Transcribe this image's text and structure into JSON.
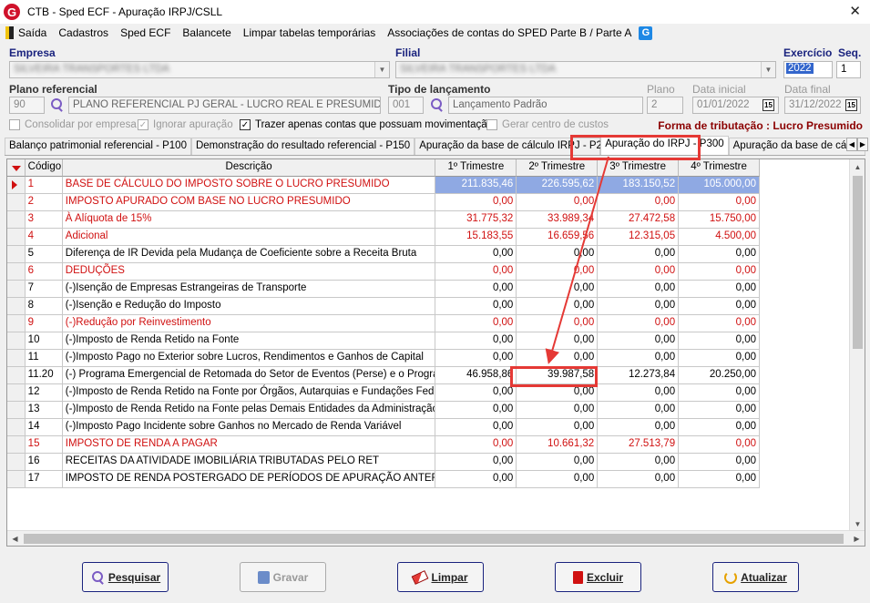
{
  "window": {
    "title": "CTB - Sped ECF - Apuração IRPJ/CSLL"
  },
  "menu": {
    "items": [
      "Saída",
      "Cadastros",
      "Sped ECF",
      "Balancete",
      "Limpar tabelas temporárias",
      "Associações de contas do SPED Parte B / Parte A"
    ]
  },
  "form": {
    "empresa_label": "Empresa",
    "empresa_value": "SILVEIRA TRANSPORTES LTDA",
    "filial_label": "Filial",
    "filial_value": "SILVEIRA TRANSPORTES LTDA",
    "exercicio_label": "Exercício",
    "exercicio_value": "2022",
    "seq_label": "Seq.",
    "seq_value": "1",
    "plano_label": "Plano referencial",
    "plano_code": "90",
    "plano_desc": "PLANO REFERENCIAL PJ GERAL - LUCRO REAL E PRESUMIDO AN",
    "tipo_label": "Tipo de lançamento",
    "tipo_code": "001",
    "tipo_desc": "Lançamento Padrão",
    "plano2_label": "Plano",
    "plano2_value": "2",
    "data_inicial_label": "Data inicial",
    "data_inicial_value": "01/01/2022",
    "data_final_label": "Data final",
    "data_final_value": "31/12/2022",
    "cal_glyph": "15",
    "chk_consolidar": "Consolidar por empresa",
    "chk_ignorar": "Ignorar apuração",
    "chk_trazer": "Trazer apenas contas que possuam movimentação",
    "chk_gerar": "Gerar centro de custos",
    "forma_tributacao": "Forma de tributação : Lucro Presumido"
  },
  "tabs": [
    "Balanço patrimonial referencial - P100",
    "Demonstração do resultado referencial - P150",
    "Apuração da base de cálculo IRPJ - P200",
    "Apuração do IRPJ - P300",
    "Apuração da base de cálculo C"
  ],
  "grid": {
    "headers": [
      "Código",
      "Descrição",
      "1º Trimestre",
      "2º Trimestre",
      "3º Trimestre",
      "4º Trimestre"
    ],
    "rows": [
      {
        "code": "1",
        "desc": "BASE DE CÁLCULO DO IMPOSTO SOBRE O LUCRO PRESUMIDO",
        "t1": "211.835,46",
        "t2": "226.595,62",
        "t3": "183.150,52",
        "t4": "105.000,00",
        "red": true
      },
      {
        "code": "2",
        "desc": "IMPOSTO APURADO COM BASE NO LUCRO PRESUMIDO",
        "t1": "0,00",
        "t2": "0,00",
        "t3": "0,00",
        "t4": "0,00",
        "red": true
      },
      {
        "code": "3",
        "desc": "À Alíquota de 15%",
        "t1": "31.775,32",
        "t2": "33.989,34",
        "t3": "27.472,58",
        "t4": "15.750,00",
        "red": true
      },
      {
        "code": "4",
        "desc": "Adicional",
        "t1": "15.183,55",
        "t2": "16.659,56",
        "t3": "12.315,05",
        "t4": "4.500,00",
        "red": true
      },
      {
        "code": "5",
        "desc": "Diferença de IR Devida pela Mudança de Coeficiente sobre a Receita Bruta",
        "t1": "0,00",
        "t2": "0,00",
        "t3": "0,00",
        "t4": "0,00",
        "red": false
      },
      {
        "code": "6",
        "desc": "DEDUÇÕES",
        "t1": "0,00",
        "t2": "0,00",
        "t3": "0,00",
        "t4": "0,00",
        "red": true
      },
      {
        "code": "7",
        "desc": "(-)Isenção de Empresas Estrangeiras de Transporte",
        "t1": "0,00",
        "t2": "0,00",
        "t3": "0,00",
        "t4": "0,00",
        "red": false
      },
      {
        "code": "8",
        "desc": "(-)Isenção e Redução do Imposto",
        "t1": "0,00",
        "t2": "0,00",
        "t3": "0,00",
        "t4": "0,00",
        "red": false
      },
      {
        "code": "9",
        "desc": "(-)Redução por Reinvestimento",
        "t1": "0,00",
        "t2": "0,00",
        "t3": "0,00",
        "t4": "0,00",
        "red": true
      },
      {
        "code": "10",
        "desc": "(-)Imposto de Renda Retido na Fonte",
        "t1": "0,00",
        "t2": "0,00",
        "t3": "0,00",
        "t4": "0,00",
        "red": false
      },
      {
        "code": "11",
        "desc": "(-)Imposto Pago no Exterior sobre Lucros, Rendimentos e Ganhos de Capital",
        "t1": "0,00",
        "t2": "0,00",
        "t3": "0,00",
        "t4": "0,00",
        "red": false
      },
      {
        "code": "11.20",
        "desc": "(-) Programa Emergencial de Retomada do Setor de Eventos (Perse) e o Programa...",
        "t1": "46.958,86",
        "t2": "39.987,58",
        "t3": "12.273,84",
        "t4": "20.250,00",
        "red": false
      },
      {
        "code": "12",
        "desc": "(-)Imposto de Renda Retido na Fonte por Órgãos, Autarquias e Fundações Federa...",
        "t1": "0,00",
        "t2": "0,00",
        "t3": "0,00",
        "t4": "0,00",
        "red": false
      },
      {
        "code": "13",
        "desc": "(-)Imposto de Renda Retido na Fonte pelas Demais Entidades da Administração P...",
        "t1": "0,00",
        "t2": "0,00",
        "t3": "0,00",
        "t4": "0,00",
        "red": false
      },
      {
        "code": "14",
        "desc": "(-)Imposto Pago Incidente sobre Ganhos no Mercado de Renda Variável",
        "t1": "0,00",
        "t2": "0,00",
        "t3": "0,00",
        "t4": "0,00",
        "red": false
      },
      {
        "code": "15",
        "desc": "IMPOSTO DE RENDA A PAGAR",
        "t1": "0,00",
        "t2": "10.661,32",
        "t3": "27.513,79",
        "t4": "0,00",
        "red": true
      },
      {
        "code": "16",
        "desc": "RECEITAS DA ATIVIDADE IMOBILIÁRIA TRIBUTADAS PELO RET",
        "t1": "0,00",
        "t2": "0,00",
        "t3": "0,00",
        "t4": "0,00",
        "red": false
      },
      {
        "code": "17",
        "desc": "IMPOSTO DE RENDA POSTERGADO DE PERÍODOS DE APURAÇÃO ANTERI...",
        "t1": "0,00",
        "t2": "0,00",
        "t3": "0,00",
        "t4": "0,00",
        "red": false
      }
    ]
  },
  "buttons": {
    "pesquisar": "Pesquisar",
    "gravar": "Gravar",
    "limpar": "Limpar",
    "excluir": "Excluir",
    "atualizar": "Atualizar"
  },
  "colors": {
    "red": "#d01010",
    "selected": "#8fa9e3",
    "highlight": "#e53935",
    "forma": "#8b0000"
  }
}
